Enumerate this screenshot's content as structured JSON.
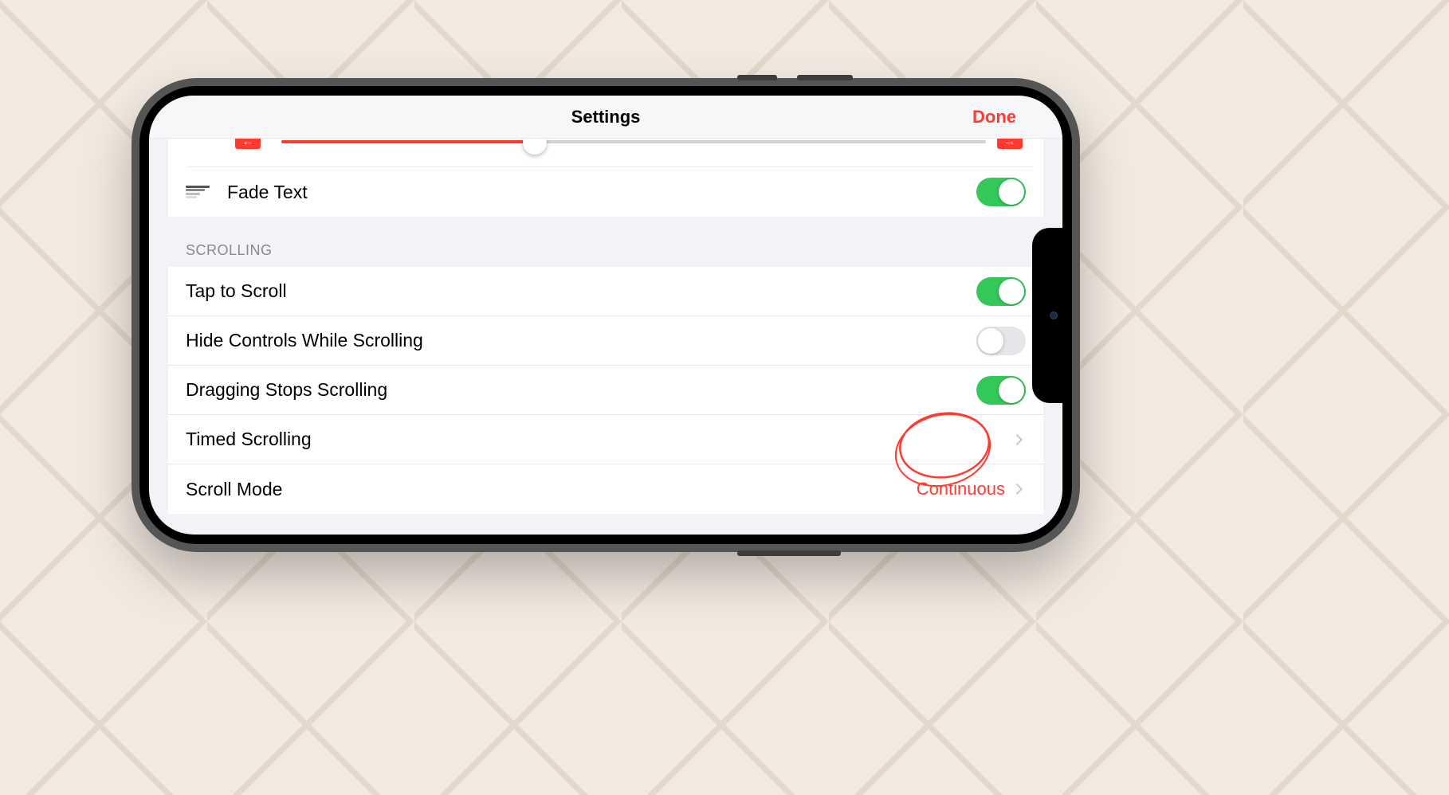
{
  "navbar": {
    "title": "Settings",
    "done": "Done"
  },
  "slider": {
    "value_percent": 36
  },
  "section1": {
    "fade_text": {
      "label": "Fade Text",
      "on": true
    }
  },
  "section2": {
    "header": "SCROLLING",
    "tap_to_scroll": {
      "label": "Tap to Scroll",
      "on": true
    },
    "hide_controls": {
      "label": "Hide Controls While Scrolling",
      "on": false
    },
    "dragging_stops": {
      "label": "Dragging Stops Scrolling",
      "on": true
    },
    "timed_scrolling": {
      "label": "Timed Scrolling"
    },
    "scroll_mode": {
      "label": "Scroll Mode",
      "detail": "Continuous"
    }
  },
  "colors": {
    "accent_red": "#ff3b30",
    "switch_green": "#34c759"
  }
}
